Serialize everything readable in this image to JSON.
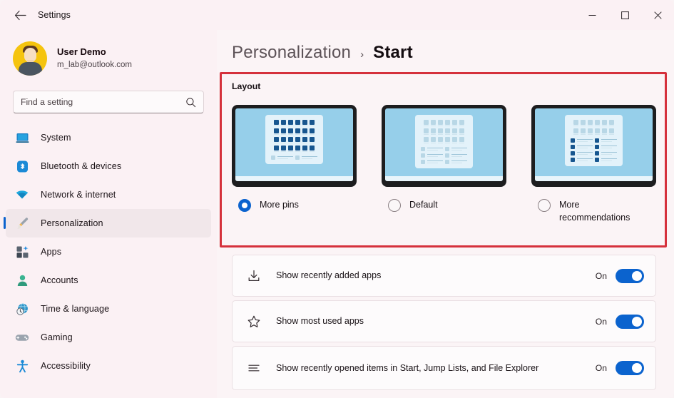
{
  "window": {
    "title": "Settings",
    "back_icon": "back-arrow-icon",
    "controls": {
      "minimize": "minimize-icon",
      "maximize": "maximize-icon",
      "close": "close-icon"
    }
  },
  "sidebar": {
    "profile": {
      "name": "User Demo",
      "email": "m_lab@outlook.com",
      "avatar": "user-avatar"
    },
    "search": {
      "placeholder": "Find a setting",
      "value": "",
      "icon": "search-icon"
    },
    "items": [
      {
        "label": "System",
        "icon": "system-icon",
        "selected": false
      },
      {
        "label": "Bluetooth & devices",
        "icon": "bluetooth-icon",
        "selected": false
      },
      {
        "label": "Network & internet",
        "icon": "wifi-icon",
        "selected": false
      },
      {
        "label": "Personalization",
        "icon": "paintbrush-icon",
        "selected": true
      },
      {
        "label": "Apps",
        "icon": "apps-icon",
        "selected": false
      },
      {
        "label": "Accounts",
        "icon": "accounts-icon",
        "selected": false
      },
      {
        "label": "Time & language",
        "icon": "clock-globe-icon",
        "selected": false
      },
      {
        "label": "Gaming",
        "icon": "gamepad-icon",
        "selected": false
      },
      {
        "label": "Accessibility",
        "icon": "accessibility-icon",
        "selected": false
      }
    ]
  },
  "main": {
    "breadcrumb": {
      "parent": "Personalization",
      "separator": "›",
      "current": "Start"
    },
    "layout_section": {
      "label": "Layout",
      "highlight_color": "#d5313c",
      "options": [
        {
          "label": "More pins",
          "selected": true,
          "pin_rows": 4,
          "pin_cols": 6,
          "rec_rows": 1,
          "rec_cols": 2,
          "pin_style": "dark",
          "rec_style": "light"
        },
        {
          "label": "Default",
          "selected": false,
          "pin_rows": 3,
          "pin_cols": 6,
          "rec_rows": 3,
          "rec_cols": 2,
          "pin_style": "light",
          "rec_style": "light"
        },
        {
          "label": "More recommendations",
          "selected": false,
          "pin_rows": 2,
          "pin_cols": 6,
          "rec_rows": 4,
          "rec_cols": 2,
          "pin_style": "light",
          "rec_style": "dark"
        }
      ]
    },
    "settings": [
      {
        "label": "Show recently added apps",
        "icon": "download-icon",
        "state": "On",
        "toggle_on": true
      },
      {
        "label": "Show most used apps",
        "icon": "star-icon",
        "state": "On",
        "toggle_on": true
      },
      {
        "label": "Show recently opened items in Start, Jump Lists, and File Explorer",
        "icon": "list-icon",
        "state": "On",
        "toggle_on": true
      }
    ]
  },
  "colors": {
    "accent": "#0b63ce",
    "highlight": "#d5313c",
    "page_bg": "#fbf4f6",
    "sidebar_bg": "#fbf1f4"
  }
}
